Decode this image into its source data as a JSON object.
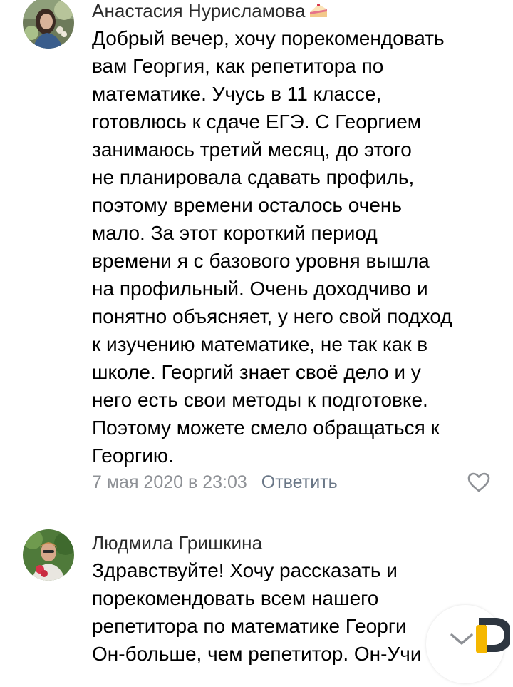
{
  "comments": [
    {
      "author": "Анастасия Нурисламова",
      "author_emoji": "cake-icon",
      "text": "Добрый вечер, хочу порекомендовать\nвам Георгия, как репетитора по\nматематике. Учусь в 11 классе,\nготовлюсь к сдаче ЕГЭ. С Георгием\nзанимаюсь третий месяц, до этого\nне планировала сдавать профиль,\nпоэтому времени осталось очень\nмало. За этот короткий  период\nвремени я с базового уровня вышла\nна профильный. Очень доходчиво и\nпонятно объясняет, у него свой подход\nк изучению математике, не так как в\nшколе. Георгий знает своё дело и у\nнего есть свои методы к подготовке.\nПоэтому можете смело обращаться  к\nГеоргию.",
      "date": "7 мая 2020 в 23:03",
      "reply_label": "Ответить",
      "like_icon": "heart-outline-icon"
    },
    {
      "author": "Людмила Гришкина",
      "text": "Здравствуйте! Хочу рассказать и\nпорекомендовать всем нашего\nрепетитора по математике Георги\nОн-больше, чем репетитор. Он-Учи"
    }
  ],
  "floating_button_icon": "chevron-down-icon",
  "app_logo_icon": "app-logo-icon",
  "colors": {
    "author": "#2a2a2a",
    "date": "#8e9196",
    "reply": "#6a7787",
    "like": "#8e9196",
    "logo_yellow": "#f5b700",
    "logo_dark": "#2e3640"
  }
}
